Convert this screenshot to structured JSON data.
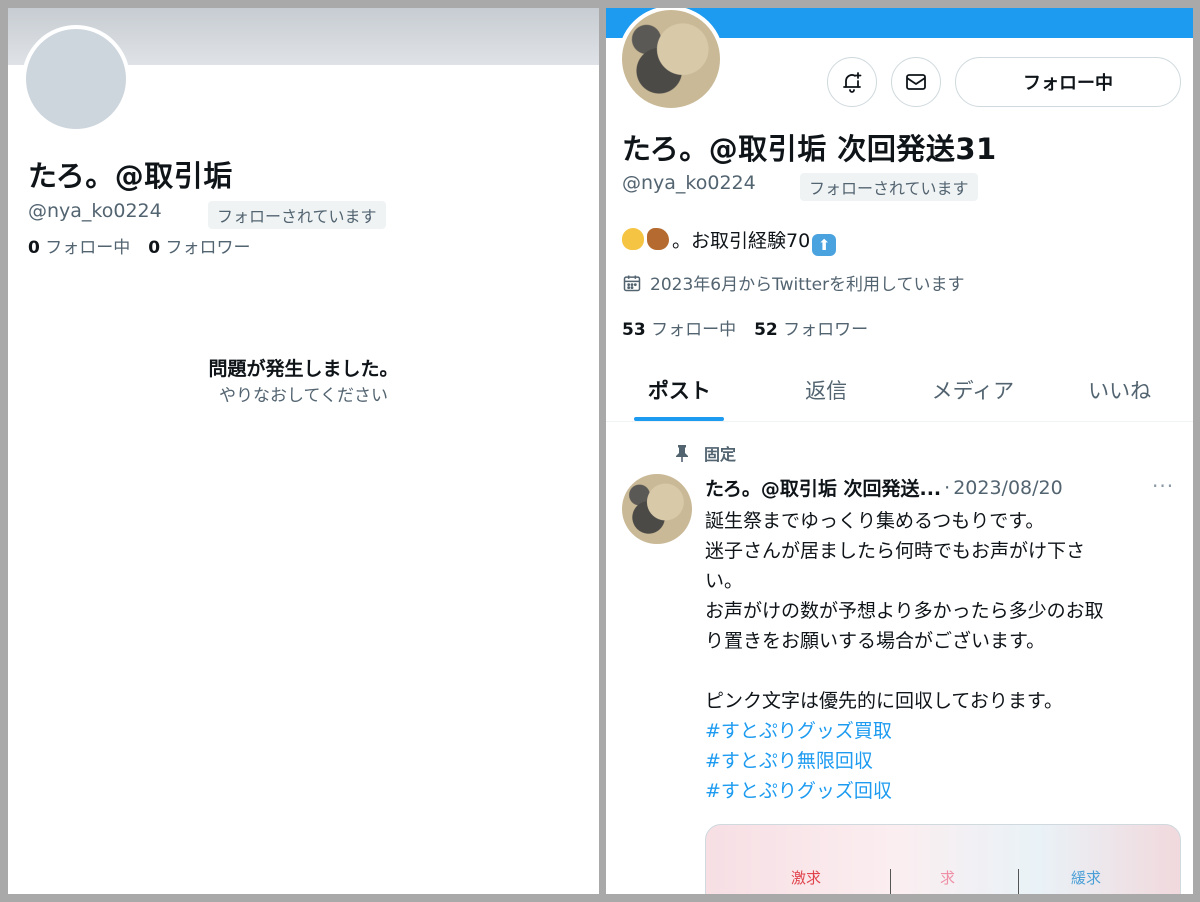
{
  "left_panel": {
    "display_name": "たろ。@取引垢",
    "handle": "@nya_ko0224",
    "follows_you_badge": "フォローされています",
    "following_count": "0",
    "following_label": "フォロー中",
    "followers_count": "0",
    "followers_label": "フォロワー",
    "error_title": "問題が発生しました。",
    "error_subtitle": "やりなおしてください"
  },
  "right_panel": {
    "follow_button_label": "フォロー中",
    "display_name": "たろ。@取引垢 次回発送31",
    "handle": "@nya_ko0224",
    "follows_you_badge": "フォローされています",
    "bio_text": "。お取引経験70",
    "joined_text": "2023年6月からTwitterを利用しています",
    "following_count": "53",
    "following_label": "フォロー中",
    "followers_count": "52",
    "followers_label": "フォロワー",
    "tabs": [
      {
        "label": "ポスト",
        "active": true
      },
      {
        "label": "返信",
        "active": false
      },
      {
        "label": "メディア",
        "active": false
      },
      {
        "label": "いいね",
        "active": false
      }
    ],
    "pinned_label": "固定",
    "tweet": {
      "author": "たろ。@取引垢 次回発送...",
      "separator": "·",
      "date": "2023/08/20",
      "more": "···",
      "lines": [
        "誕生祭までゆっくり集めるつもりです。",
        "迷子さんが居ましたら何時でもお声がけ下さ",
        "い。",
        "お声がけの数が予想より多かったら多少のお取",
        "り置きをお願いする場合がございます。",
        "",
        "ピンク文字は優先的に回収しております。"
      ],
      "hashtags": [
        "#すとぷりグッズ買取",
        " #すとぷり無限回収",
        " #すとぷりグッズ回収"
      ],
      "media_texts": [
        "激求",
        "求",
        "緩求"
      ]
    }
  },
  "colors": {
    "accent": "#1d9bf0",
    "secondary_text": "#536471",
    "primary_text": "#0f1419"
  }
}
